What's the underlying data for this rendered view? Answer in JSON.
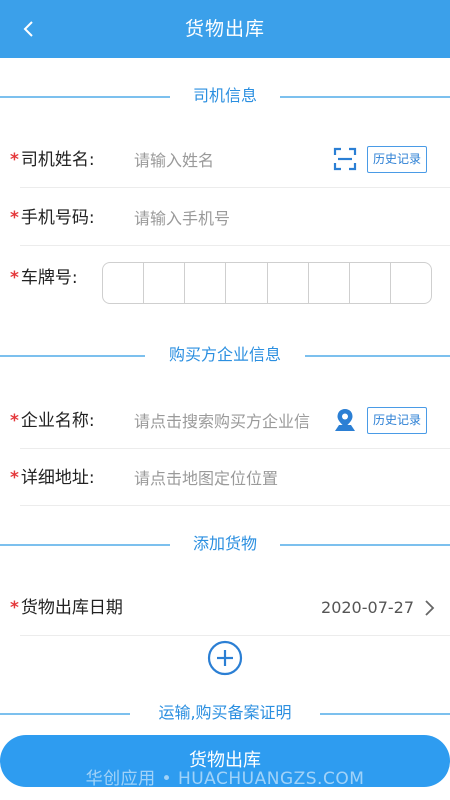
{
  "header": {
    "title": "货物出库"
  },
  "sections": {
    "driver": "司机信息",
    "buyer": "购买方企业信息",
    "goods": "添加货物",
    "proof": "运输,购买备案证明"
  },
  "driver_form": {
    "name_label": "司机姓名:",
    "name_placeholder": "请输入姓名",
    "history_label": "历史记录",
    "phone_label": "手机号码:",
    "phone_placeholder": "请输入手机号",
    "plate_label": "车牌号:"
  },
  "buyer_form": {
    "company_label": "企业名称:",
    "company_placeholder": "请点击搜索购买方企业信",
    "history_label": "历史记录",
    "address_label": "详细地址:",
    "address_placeholder": "请点击地图定位位置"
  },
  "goods_form": {
    "date_label": "货物出库日期",
    "date_value": "2020-07-27"
  },
  "required_mark": "*",
  "submit_label": "货物出库",
  "watermark": "华创应用 • HUACHUANGZS.COM",
  "colors": {
    "header": "#3ba0ea",
    "accent": "#2b8fe0",
    "required": "#e4393c",
    "button": "#2e9cf0"
  }
}
